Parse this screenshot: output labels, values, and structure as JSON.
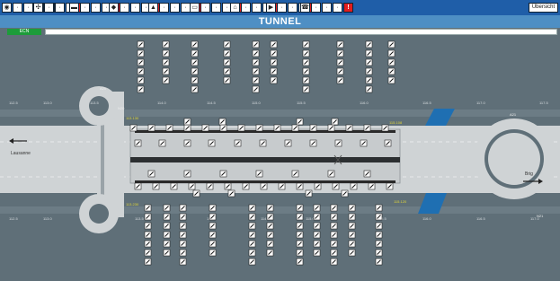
{
  "window": {
    "title": "TUNNEL",
    "overview_label": "Übersicht"
  },
  "status": {
    "badge_label": "ECN",
    "message": ""
  },
  "toolbar": {
    "groups": [
      {
        "icon": "camera-icon",
        "alert_label": "!"
      },
      {
        "icon": "fan-icon",
        "alert_label": "!"
      },
      {
        "icon": "truck-icon",
        "alert_label": "!"
      },
      {
        "icon": "traffic-sign-icon",
        "alert_label": "!"
      },
      {
        "icon": "fire-alarm-icon",
        "alert_label": "!"
      },
      {
        "icon": "lane-signal-icon",
        "alert_label": "!"
      },
      {
        "icon": "building-icon",
        "alert_label": "!"
      },
      {
        "icon": "play-icon",
        "alert_label": "!"
      },
      {
        "icon": "phone-icon",
        "alert_label": "!"
      }
    ]
  },
  "map": {
    "left_destination": "Lausanne",
    "right_destination": "Brig",
    "top_kilometers": [
      "112.5",
      "113.0",
      "113.5",
      "114.0",
      "114.5",
      "115.0",
      "115.5",
      "116.0",
      "116.5",
      "117.0",
      "117.5"
    ],
    "bottom_kilometers": [
      "112.5",
      "113.0",
      "113.5",
      "114.0",
      "114.5",
      "115.0",
      "115.5",
      "116.0",
      "116.5",
      "117.0"
    ],
    "top_portal_labels": [
      "113.130",
      "115.108"
    ],
    "bottom_portal_labels": [
      "113.230",
      "115.120"
    ],
    "junction_labels": [
      "A20",
      "N20",
      "A21",
      "N21"
    ],
    "colors": {
      "road": "#cfd3d5",
      "background": "#5f6f78",
      "bridge": "#1f6fb2",
      "tunnel_tube": "#2c2f31",
      "label": "#e0d63a"
    }
  }
}
